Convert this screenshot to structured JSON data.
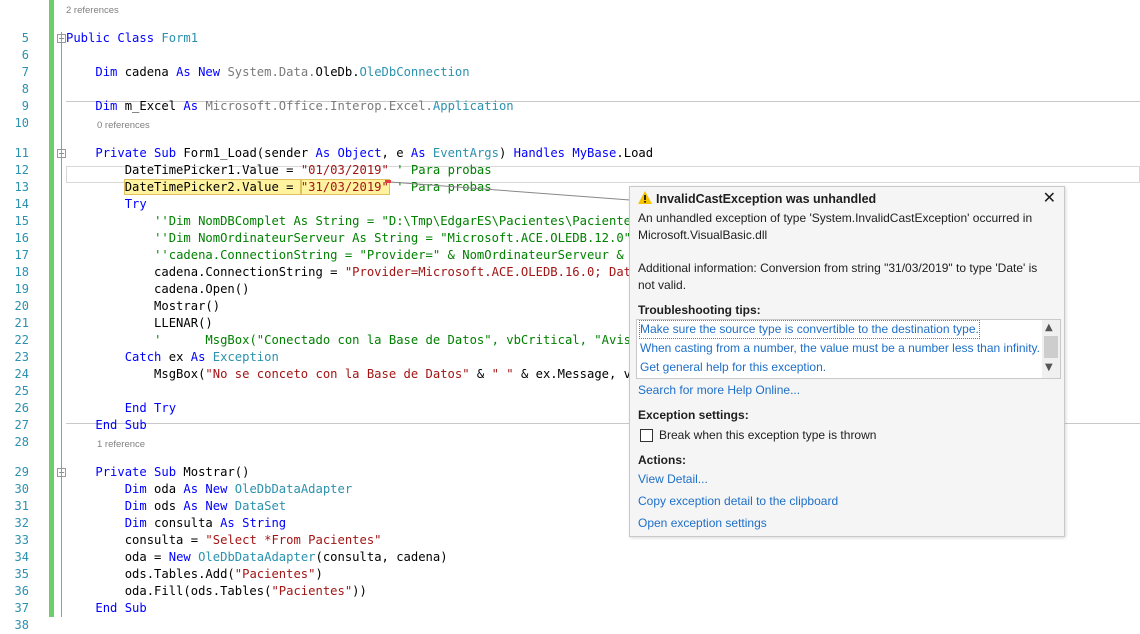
{
  "editor": {
    "lines": [
      {
        "n": "5",
        "lens": "2 references",
        "fold": "minus",
        "tokens": [
          [
            "kw",
            "Public Class "
          ],
          [
            "ty",
            "Form1"
          ]
        ]
      },
      {
        "n": "6",
        "tokens": []
      },
      {
        "n": "7",
        "tokens": [
          [
            "",
            "    "
          ],
          [
            "kw",
            "Dim"
          ],
          [
            "",
            " cadena "
          ],
          [
            "kw",
            "As New "
          ],
          [
            "ns",
            "System.Data."
          ],
          [
            "",
            "OleDb."
          ],
          [
            "ty",
            "OleDbConnection"
          ]
        ]
      },
      {
        "n": "8",
        "tokens": []
      },
      {
        "n": "9",
        "tokens": [
          [
            "",
            "    "
          ],
          [
            "kw",
            "Dim"
          ],
          [
            "",
            " m_Excel "
          ],
          [
            "kw",
            "As "
          ],
          [
            "ns",
            "Microsoft.Office.Interop.Excel."
          ],
          [
            "ty",
            "Application"
          ]
        ]
      },
      {
        "n": "10",
        "tokens": []
      },
      {
        "n": "11",
        "lens": "0 references",
        "fold": "minus",
        "tokens": [
          [
            "",
            "    "
          ],
          [
            "kw",
            "Private Sub"
          ],
          [
            "",
            " Form1_Load(sender "
          ],
          [
            "kw",
            "As Object"
          ],
          [
            ", e "
          ],
          [
            "kw",
            "As "
          ],
          [
            "ty",
            "EventArgs"
          ],
          [
            ") "
          ],
          [
            "kw",
            "Handles MyBase"
          ],
          [
            ".Load"
          ]
        ]
      },
      {
        "n": "12",
        "tokens": [
          [
            "",
            "        DateTimePicker1.Value = "
          ],
          [
            "st",
            "\"01/03/2019\""
          ],
          [
            "cm",
            " ' Para probas"
          ]
        ]
      },
      {
        "n": "13",
        "tokens": [
          [
            "",
            "        "
          ],
          [
            "hl",
            "DateTimePicker2.Value = "
          ],
          [
            "hlst",
            "\"31/03/2019\""
          ],
          [
            "cm",
            " ' Para probas"
          ]
        ]
      },
      {
        "n": "14",
        "tokens": [
          [
            "",
            "        "
          ],
          [
            "kw",
            "Try"
          ]
        ]
      },
      {
        "n": "15",
        "tokens": [
          [
            "",
            "            "
          ],
          [
            "cm",
            "''Dim NomDBComplet As String = \"D:\\Tmp\\EdgarES\\Pacientes\\Pacientes"
          ]
        ]
      },
      {
        "n": "16",
        "tokens": [
          [
            "",
            "            "
          ],
          [
            "cm",
            "''Dim NomOrdinateurServeur As String = \"Microsoft.ACE.OLEDB.12.0\""
          ]
        ]
      },
      {
        "n": "17",
        "tokens": [
          [
            "",
            "            "
          ],
          [
            "cm",
            "''cadena.ConnectionString = \"Provider=\" & NomOrdinateurServeur & "
          ]
        ]
      },
      {
        "n": "18",
        "tokens": [
          [
            "",
            "            cadena.ConnectionString = "
          ],
          [
            "st",
            "\"Provider=Microsoft.ACE.OLEDB.16.0; Dat"
          ]
        ]
      },
      {
        "n": "19",
        "tokens": [
          [
            "",
            "            cadena.Open()"
          ]
        ]
      },
      {
        "n": "20",
        "tokens": [
          [
            "",
            "            Mostrar()"
          ]
        ]
      },
      {
        "n": "21",
        "tokens": [
          [
            "",
            "            LLENAR()"
          ]
        ]
      },
      {
        "n": "22",
        "tokens": [
          [
            "",
            "            "
          ],
          [
            "cm",
            "'      MsgBox(\"Conectado con la Base de Datos\", vbCritical, \"Avis"
          ]
        ]
      },
      {
        "n": "23",
        "tokens": [
          [
            "",
            "        "
          ],
          [
            "kw",
            "Catch"
          ],
          [
            "",
            " ex "
          ],
          [
            "kw",
            "As "
          ],
          [
            "ty",
            "Exception"
          ]
        ]
      },
      {
        "n": "24",
        "tokens": [
          [
            "",
            "            MsgBox("
          ],
          [
            "st",
            "\"No se conceto con la Base de Datos\""
          ],
          [
            "",
            " & "
          ],
          [
            "st",
            "\" \""
          ],
          [
            "",
            " & ex.Message, v"
          ]
        ]
      },
      {
        "n": "25",
        "tokens": []
      },
      {
        "n": "26",
        "tokens": [
          [
            "",
            "        "
          ],
          [
            "kw",
            "End Try"
          ]
        ]
      },
      {
        "n": "27",
        "tokens": [
          [
            "",
            "    "
          ],
          [
            "kw",
            "End Sub"
          ]
        ]
      },
      {
        "n": "28",
        "tokens": []
      },
      {
        "n": "29",
        "lens": "1 reference",
        "fold": "minus",
        "tokens": [
          [
            "",
            "    "
          ],
          [
            "kw",
            "Private Sub"
          ],
          [
            "",
            " Mostrar()"
          ]
        ]
      },
      {
        "n": "30",
        "tokens": [
          [
            "",
            "        "
          ],
          [
            "kw",
            "Dim"
          ],
          [
            "",
            " oda "
          ],
          [
            "kw",
            "As New "
          ],
          [
            "ty",
            "OleDbDataAdapter"
          ]
        ]
      },
      {
        "n": "31",
        "tokens": [
          [
            "",
            "        "
          ],
          [
            "kw",
            "Dim"
          ],
          [
            "",
            " ods "
          ],
          [
            "kw",
            "As New "
          ],
          [
            "ty",
            "DataSet"
          ]
        ]
      },
      {
        "n": "32",
        "tokens": [
          [
            "",
            "        "
          ],
          [
            "kw",
            "Dim"
          ],
          [
            "",
            " consulta "
          ],
          [
            "kw",
            "As String"
          ]
        ]
      },
      {
        "n": "33",
        "tokens": [
          [
            "",
            "        consulta = "
          ],
          [
            "st",
            "\"Select *From Pacientes\""
          ]
        ]
      },
      {
        "n": "34",
        "tokens": [
          [
            "",
            "        oda = "
          ],
          [
            "kw",
            "New "
          ],
          [
            "ty",
            "OleDbDataAdapter"
          ],
          [
            "",
            "(consulta, cadena)"
          ]
        ]
      },
      {
        "n": "35",
        "tokens": [
          [
            "",
            "        ods.Tables.Add("
          ],
          [
            "st",
            "\"Pacientes\""
          ],
          [
            ")"
          ]
        ]
      },
      {
        "n": "36",
        "tokens": [
          [
            "",
            "        oda.Fill(ods.Tables("
          ],
          [
            "st",
            "\"Pacientes\""
          ],
          [
            "",
            "))"
          ]
        ]
      },
      {
        "n": "37",
        "tokens": [
          [
            "",
            "    "
          ],
          [
            "kw",
            "End Sub"
          ]
        ]
      },
      {
        "n": "38",
        "tokens": []
      }
    ]
  },
  "exception": {
    "icon": "warning-icon",
    "title": "InvalidCastException was unhandled",
    "close": "✕",
    "message": "An unhandled exception of type 'System.InvalidCastException' occurred in Microsoft.VisualBasic.dll",
    "additional": "Additional information: Conversion from string \"31/03/2019\" to type 'Date' is not valid.",
    "tips_header": "Troubleshooting tips:",
    "tips": [
      "Make sure the source type is convertible to the destination type.",
      "When casting from a number, the value must be a number less than infinity.",
      "Get general help for this exception."
    ],
    "search_link": "Search for more Help Online...",
    "settings_header": "Exception settings:",
    "break_checkbox": {
      "label": "Break when this exception type is thrown",
      "checked": false
    },
    "actions_header": "Actions:",
    "actions": [
      "View Detail...",
      "Copy exception detail to the clipboard",
      "Open exception settings"
    ],
    "colors": {
      "link": "#1e6fc8",
      "keyword": "#0000ff",
      "type": "#2b91af",
      "string": "#a31515",
      "comment": "#008000"
    }
  }
}
